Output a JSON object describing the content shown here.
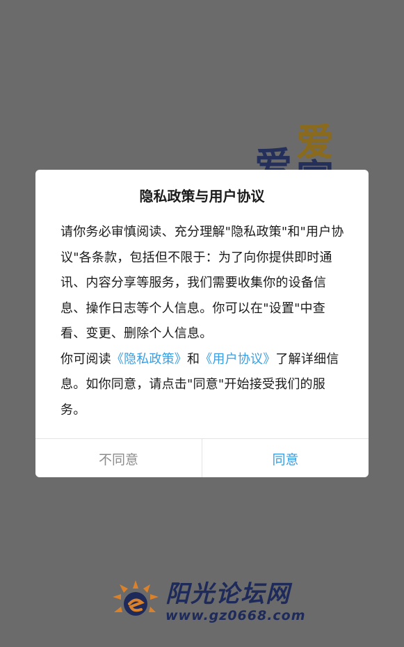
{
  "splash": {
    "deco_char_top": "爱",
    "deco_char_left": "爱",
    "deco_char_bottom": "富",
    "logo": {
      "name": "阳光论坛网",
      "url": "www.gz0668.com"
    }
  },
  "dialog": {
    "title": "隐私政策与用户协议",
    "paragraph1": "请你务必审慎阅读、充分理解\"隐私政策\"和\"用户协议\"各条款，包括但不限于：为了向你提供即时通讯、内容分享等服务，我们需要收集你的设备信息、操作日志等个人信息。你可以在\"设置\"中查看、变更、删除个人信息。",
    "paragraph2": {
      "prefix": "你可阅读",
      "privacy_link": "《隐私政策》",
      "and": "和",
      "agreement_link": "《用户协议》",
      "suffix": "了解详细信息。如你同意，请点击\"同意\"开始接受我们的服务。"
    },
    "buttons": {
      "disagree": "不同意",
      "agree": "同意"
    }
  },
  "colors": {
    "overlay": "#6b6b6b",
    "dialog_bg": "#ffffff",
    "link": "#3a9ee3",
    "disagree_text": "#8c8c8c",
    "logo_navy": "#1d2a5a",
    "logo_orange": "#d9822b"
  }
}
